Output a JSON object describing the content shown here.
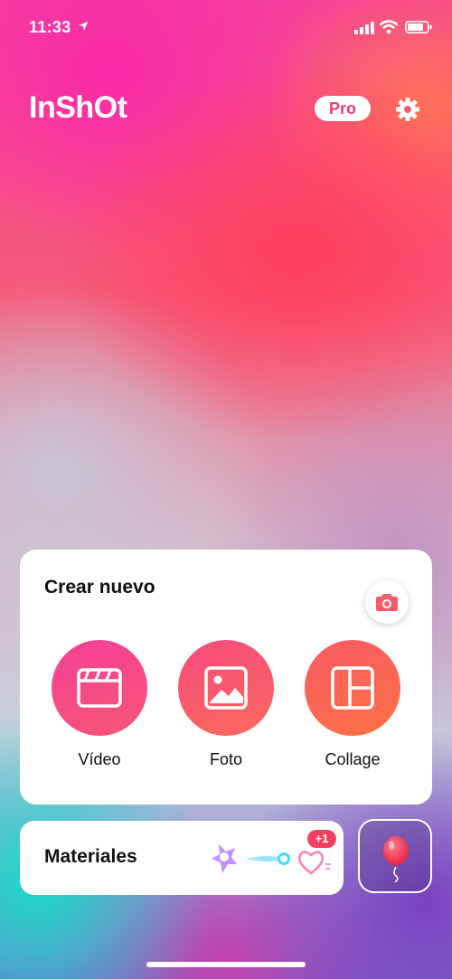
{
  "status_bar": {
    "time": "11:33",
    "icons": [
      "location-arrow-icon",
      "signal-icon",
      "wifi-icon",
      "battery-icon"
    ]
  },
  "header": {
    "logo": "InShOt",
    "pro_label": "Pro",
    "settings_icon": "gear-icon"
  },
  "create_card": {
    "title": "Crear nuevo",
    "camera_icon": "camera-icon",
    "actions": [
      {
        "label": "Vídeo",
        "icon": "clapperboard-icon",
        "color": "#f5478e"
      },
      {
        "label": "Foto",
        "icon": "image-icon",
        "color": "#f8566f"
      },
      {
        "label": "Collage",
        "icon": "collage-grid-icon",
        "color": "#fb6a4a"
      }
    ]
  },
  "materials": {
    "label": "Materiales",
    "badge": "+1",
    "stickers": [
      "star-sticker-icon",
      "comet-sticker-icon",
      "heart-sticker-icon"
    ]
  },
  "balloon_button": {
    "icon": "balloon-icon"
  },
  "colors": {
    "accent": "#f23a73",
    "card": "#ffffff"
  }
}
